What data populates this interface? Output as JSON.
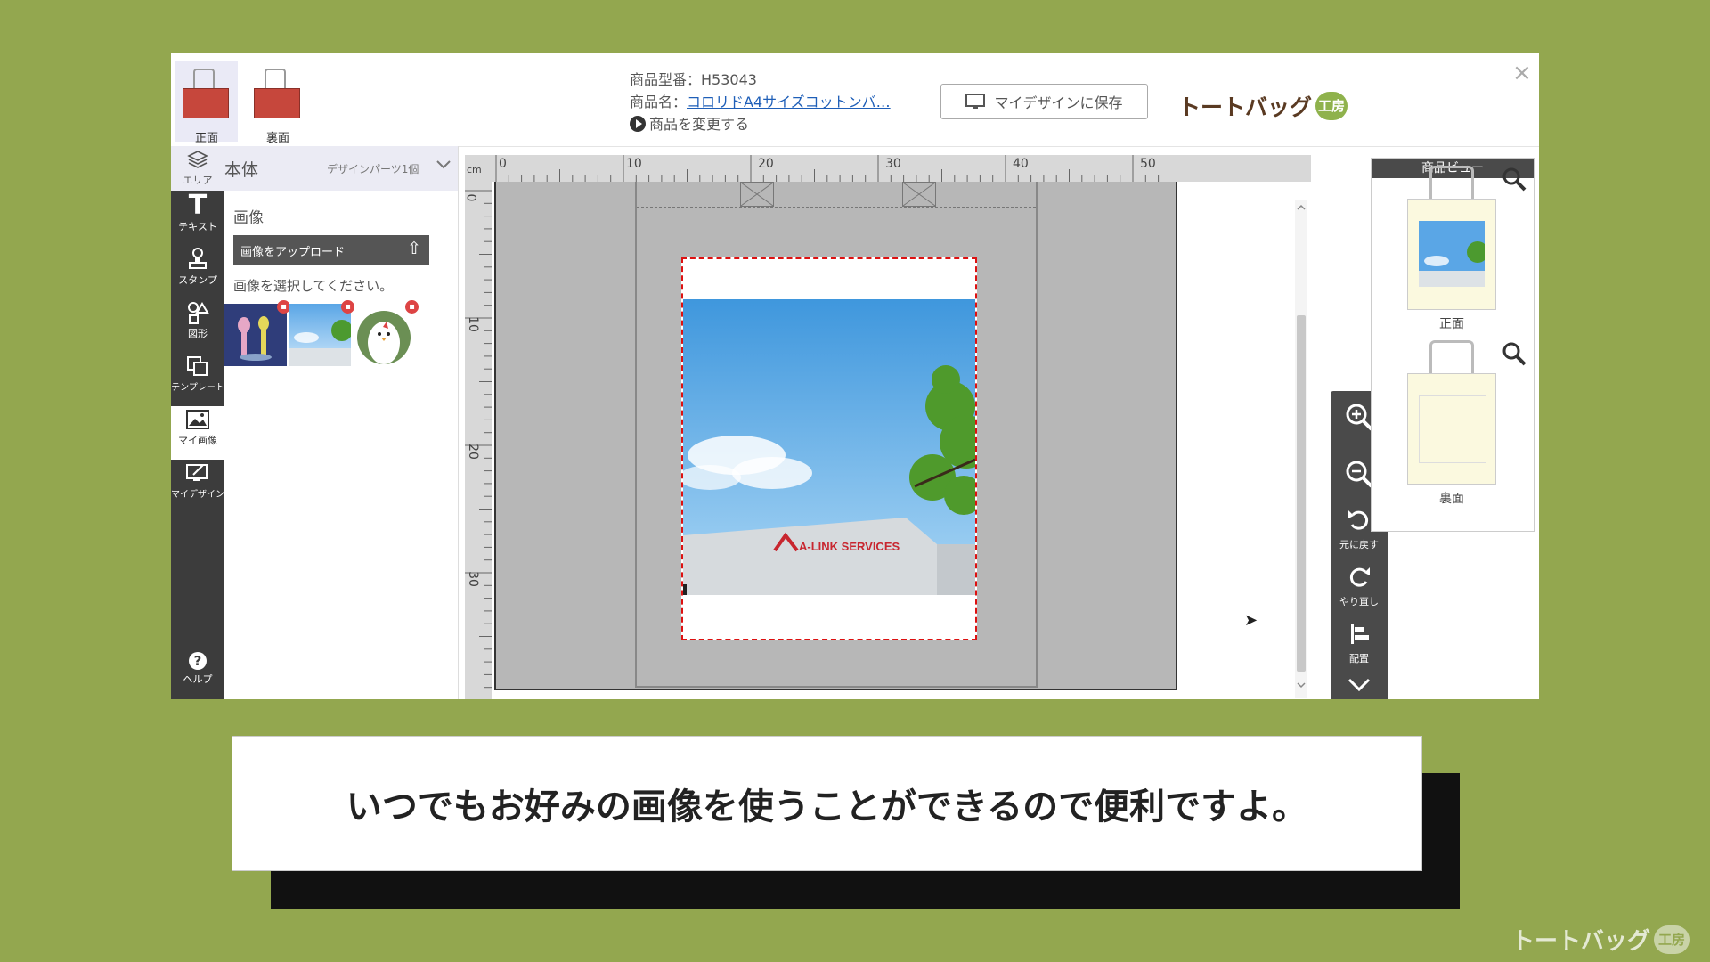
{
  "tabs": {
    "front": "正面",
    "back": "裏面"
  },
  "product": {
    "code_label": "商品型番：H53043",
    "name_prefix": "商品名：",
    "name_link": "コロリドA4サイズコットンバ…",
    "change_label": "商品を変更する"
  },
  "save_button": "マイデザインに保存",
  "logo": {
    "text": "トートバッグ",
    "badge": "工房"
  },
  "close": "×",
  "toolbar": {
    "area": "エリア",
    "text": "テキスト",
    "stamp": "スタンプ",
    "shape": "図形",
    "template": "テンプレート",
    "my_image": "マイ画像",
    "my_design": "マイデザイン",
    "help": "ヘルプ"
  },
  "panel": {
    "title": "本体",
    "parts": "デザインパーツ1個",
    "section": "画像",
    "upload": "画像をアップロード",
    "hint": "画像を選択してください。"
  },
  "ruler": {
    "unit": "cm",
    "top": [
      "0",
      "10",
      "20",
      "30",
      "40",
      "50"
    ],
    "left": [
      "0",
      "10",
      "20",
      "30"
    ]
  },
  "photo_sign": "A-LINK SERVICES",
  "zoom_tools": {
    "undo": "元に戻す",
    "redo": "やり直し",
    "arrange": "配置"
  },
  "product_view": {
    "title": "商品ビュー",
    "front": "正面",
    "back": "裏面"
  },
  "caption": "いつでもお好みの画像を使うことができるので便利ですよ。",
  "watermark": {
    "text": "トートバッグ",
    "badge": "工房"
  }
}
